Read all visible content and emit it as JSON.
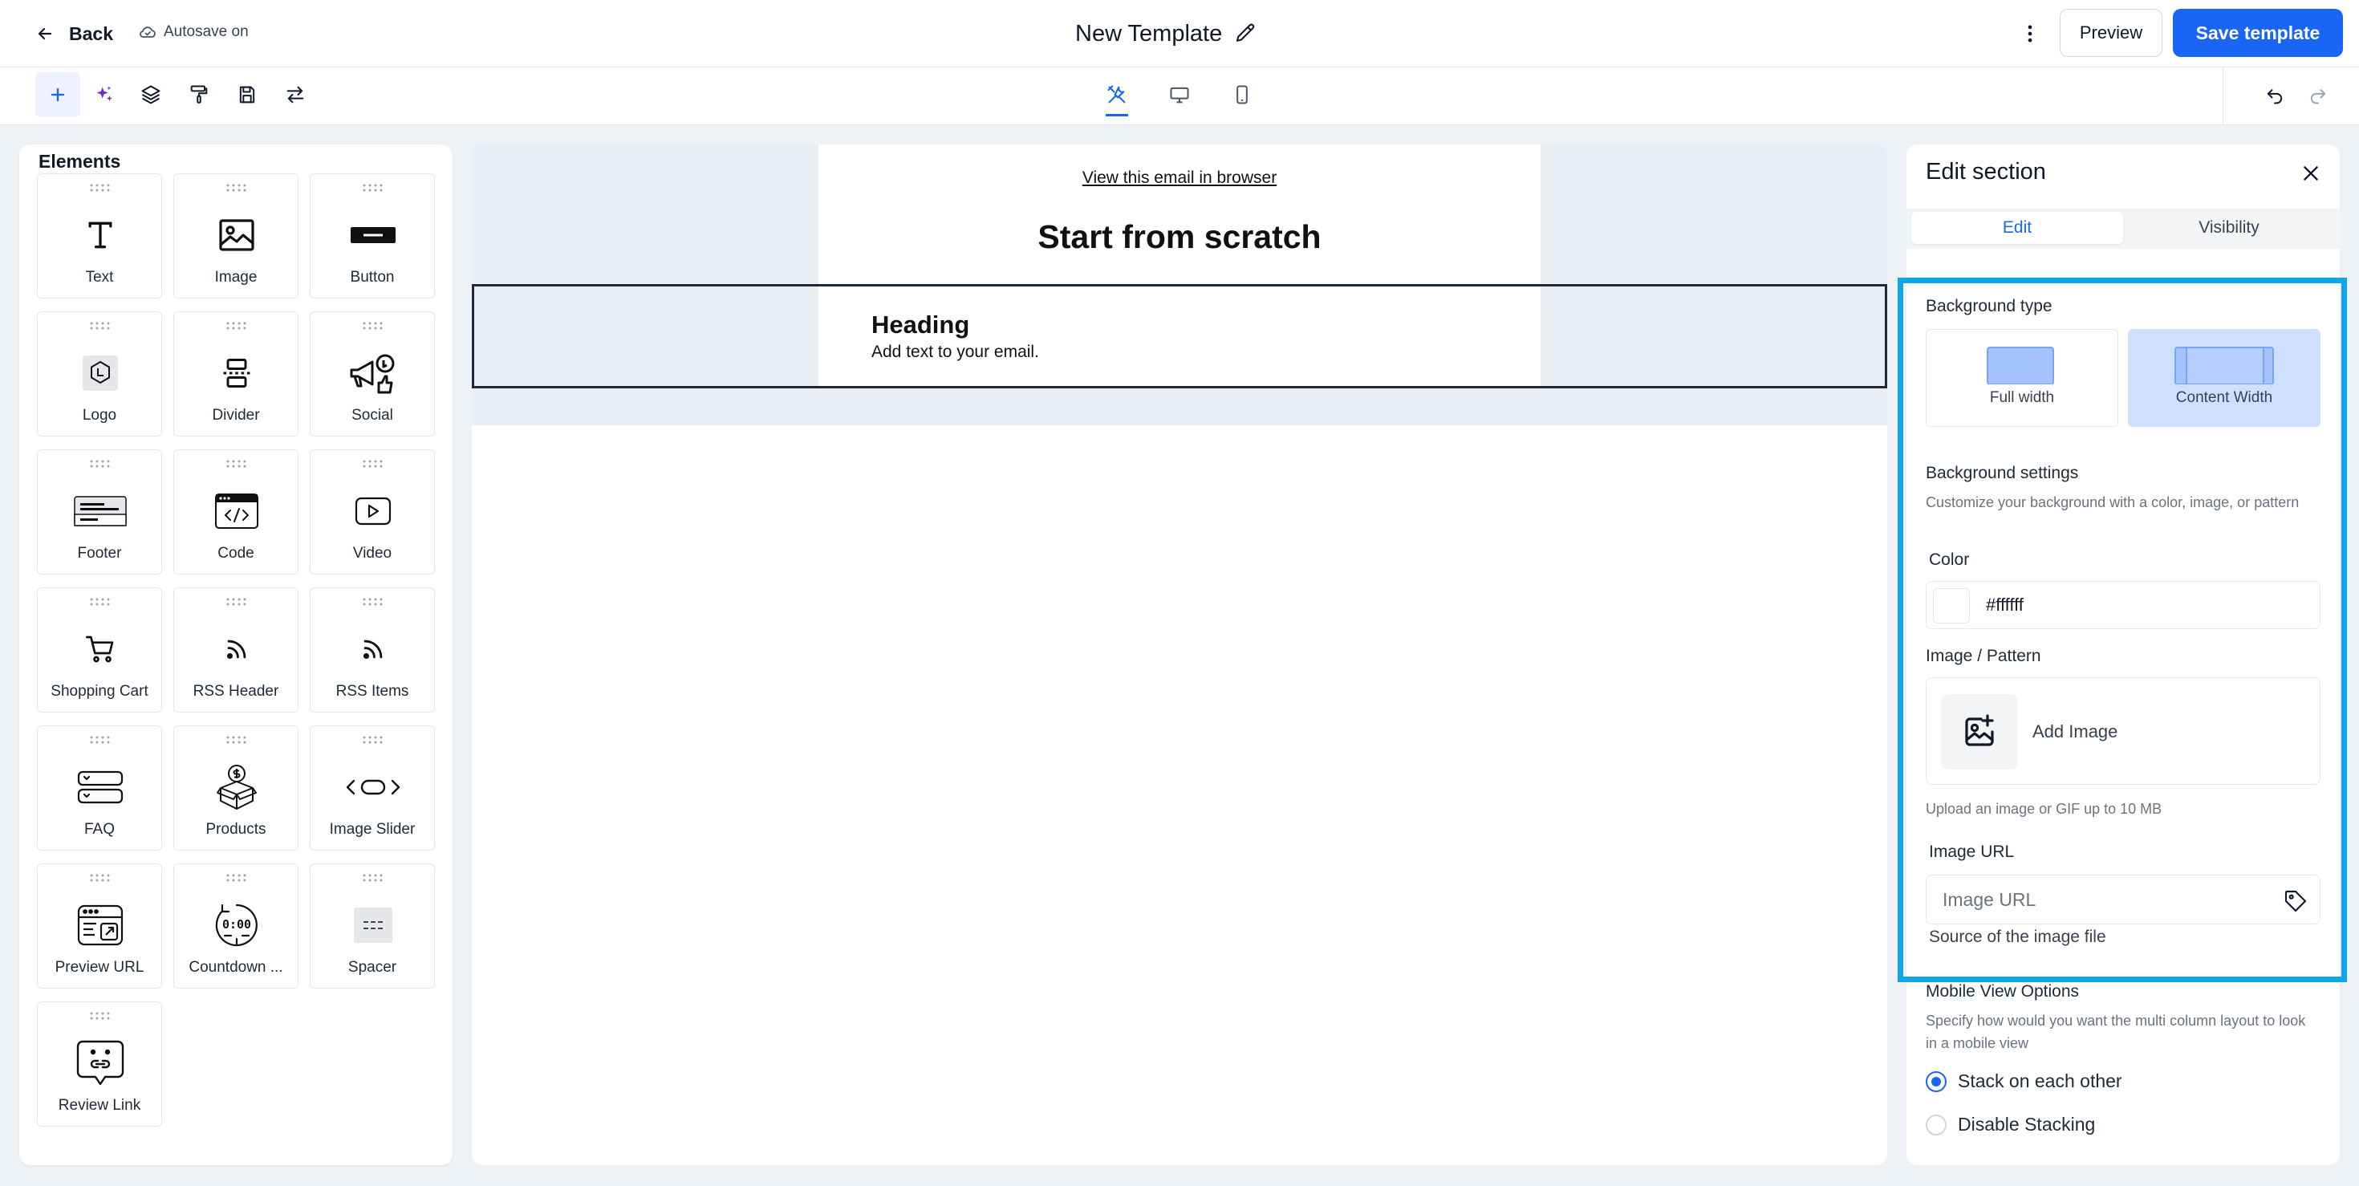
{
  "header": {
    "back_label": "Back",
    "autosave_label": "Autosave on",
    "template_title": "New Template",
    "preview_label": "Preview",
    "save_label": "Save template"
  },
  "elements_panel": {
    "title": "Elements",
    "items": [
      {
        "label": "Text",
        "icon": "text-icon"
      },
      {
        "label": "Image",
        "icon": "image-icon"
      },
      {
        "label": "Button",
        "icon": "button-icon"
      },
      {
        "label": "Logo",
        "icon": "logo-icon"
      },
      {
        "label": "Divider",
        "icon": "divider-icon"
      },
      {
        "label": "Social",
        "icon": "social-icon"
      },
      {
        "label": "Footer",
        "icon": "footer-icon"
      },
      {
        "label": "Code",
        "icon": "code-icon"
      },
      {
        "label": "Video",
        "icon": "video-icon"
      },
      {
        "label": "Shopping Cart",
        "icon": "cart-icon"
      },
      {
        "label": "RSS Header",
        "icon": "rss-icon"
      },
      {
        "label": "RSS Items",
        "icon": "rss-icon"
      },
      {
        "label": "FAQ",
        "icon": "faq-icon"
      },
      {
        "label": "Products",
        "icon": "products-icon"
      },
      {
        "label": "Image Slider",
        "icon": "slider-icon"
      },
      {
        "label": "Preview URL",
        "icon": "preview-url-icon"
      },
      {
        "label": "Countdown ...",
        "icon": "countdown-icon"
      },
      {
        "label": "Spacer",
        "icon": "spacer-icon"
      },
      {
        "label": "Review Link",
        "icon": "review-link-icon"
      }
    ]
  },
  "canvas": {
    "view_in_browser": "View this email in browser",
    "main_title": "Start from scratch",
    "section_heading": "Heading",
    "section_text": "Add text to your email."
  },
  "edit_panel": {
    "title": "Edit section",
    "tabs": [
      "Edit",
      "Visibility"
    ],
    "background_type_label": "Background type",
    "bg_options": [
      "Full width",
      "Content Width"
    ],
    "background_settings_label": "Background settings",
    "background_settings_desc": "Customize your background with a color, image, or pattern",
    "color_label": "Color",
    "color_value": "#ffffff",
    "image_pattern_label": "Image / Pattern",
    "add_image_label": "Add Image",
    "upload_hint": "Upload an image or GIF up to 10 MB",
    "image_url_label": "Image URL",
    "image_url_placeholder": "Image URL",
    "image_url_help": "Source of the image file",
    "mobile_view_label": "Mobile View Options",
    "mobile_view_desc": "Specify how would you want the multi column layout to look in a mobile view",
    "radio_options": [
      "Stack on each other",
      "Disable Stacking"
    ],
    "radio_selected": "Stack on each other"
  },
  "colors": {
    "primary": "#1a66f4",
    "highlight": "#0ea5e9",
    "canvas_band": "#eaeef4",
    "selected_option": "#cfe0ff"
  }
}
